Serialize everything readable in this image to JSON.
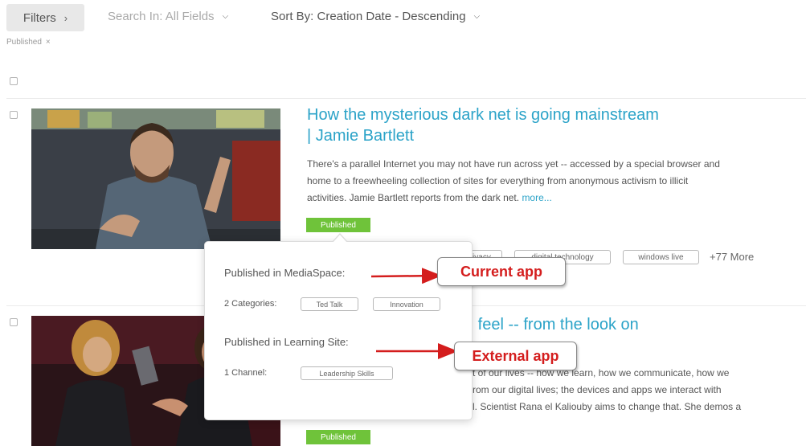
{
  "toolbar": {
    "filters_label": "Filters",
    "search_in_label": "Search In: All Fields",
    "sort_by_label": "Sort By: Creation Date - Descending"
  },
  "active_filters": [
    {
      "label": "Published",
      "remove": "×"
    }
  ],
  "entries": [
    {
      "title_line1": "How the mysterious dark net is going mainstream",
      "title_line2": "| Jamie Bartlett",
      "description_lines": [
        "There's a parallel Internet you may not have run across yet -- accessed by a special browser and",
        "home to a freewheeling collection of sites for everything from anonymous activism to illicit",
        "activities. Jamie Bartlett reports from the dark net. "
      ],
      "more_link": "more...",
      "status": "Published",
      "tags": [
        "privacy",
        "digital technology",
        "windows live"
      ],
      "more_tags": "+77 More"
    },
    {
      "title_partial": "u feel -- from the look on",
      "description_partial_lines": [
        "t of our lives -- how we learn, how we communicate, how we",
        "rom our digital lives; the devices and apps we interact with",
        "l. Scientist Rana el Kaliouby aims to change that. She demos a"
      ],
      "status": "Published"
    }
  ],
  "popover": {
    "section1_heading": "Published in MediaSpace:",
    "section1_label": "2 Categories:",
    "section1_tags": [
      "Ted Talk",
      "Innovation"
    ],
    "section2_heading": "Published in Learning Site:",
    "section2_label": "1 Channel:",
    "section2_tags": [
      "Leadership Skills"
    ]
  },
  "annotations": {
    "current_app": "Current app",
    "external_app": "External app",
    "color": "#d41d1d"
  },
  "colors": {
    "link": "#2ba3c8",
    "published": "#6fc33a"
  },
  "icons": {
    "filters_chevron": "chevron-right-icon",
    "dropdown_caret": "chevron-down-icon",
    "remove": "close-icon"
  }
}
